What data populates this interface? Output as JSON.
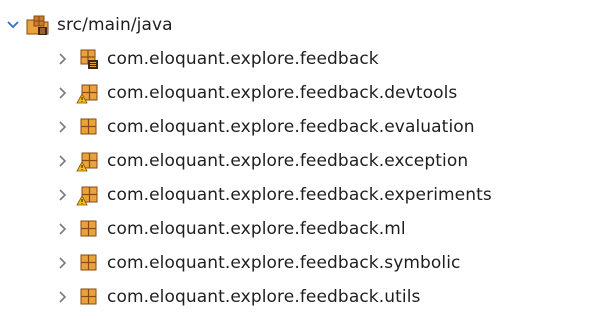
{
  "tree": {
    "root": {
      "label": "src/main/java",
      "expanded": true,
      "icon": "source-folder-icon"
    },
    "packages": [
      {
        "label": "com.eloquant.explore.feedback",
        "icon": "package-icon",
        "overlay": "binary-overlay"
      },
      {
        "label": "com.eloquant.explore.feedback.devtools",
        "icon": "package-icon",
        "overlay": "warning-overlay"
      },
      {
        "label": "com.eloquant.explore.feedback.evaluation",
        "icon": "package-icon",
        "overlay": "none"
      },
      {
        "label": "com.eloquant.explore.feedback.exception",
        "icon": "package-icon",
        "overlay": "warning-overlay"
      },
      {
        "label": "com.eloquant.explore.feedback.experiments",
        "icon": "package-icon",
        "overlay": "warning-overlay"
      },
      {
        "label": "com.eloquant.explore.feedback.ml",
        "icon": "package-icon",
        "overlay": "none"
      },
      {
        "label": "com.eloquant.explore.feedback.symbolic",
        "icon": "package-icon",
        "overlay": "none"
      },
      {
        "label": "com.eloquant.explore.feedback.utils",
        "icon": "package-icon",
        "overlay": "none"
      }
    ]
  },
  "colors": {
    "chevron_expanded": "#2b6fd0",
    "chevron_collapsed": "#7a7a7a",
    "package_brown": "#8a4a12",
    "package_amber": "#e8a33a",
    "warning_yellow": "#f5c21b",
    "overlay_dark": "#3b2a1a"
  }
}
